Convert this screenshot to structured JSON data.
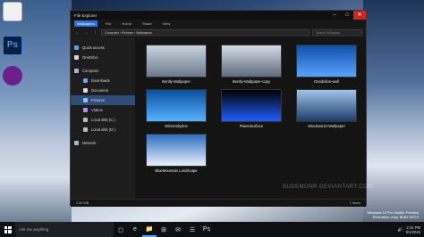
{
  "desktop": {
    "icons": [
      {
        "label": ""
      },
      {
        "label": "Ps"
      },
      {
        "label": ""
      }
    ],
    "build_info": [
      "Windows 10 Pro Insider Preview",
      "Evaluation copy. Build 10074"
    ]
  },
  "window": {
    "title": "File Explorer",
    "controls": {
      "minimize": "–",
      "maximize": "□",
      "close": "✕"
    },
    "ribbon_tabs": [
      "Wallpapers",
      "File",
      "Home",
      "Share",
      "View"
    ],
    "address": "Computer › Pictures › Wallpapers",
    "search_placeholder": "Search Windows",
    "sidebar": [
      {
        "label": "Quick access",
        "indent": false,
        "selected": false,
        "icon": "star-icon",
        "color": "#4aa3ff"
      },
      {
        "label": "OneDrive",
        "indent": false,
        "selected": false,
        "icon": "cloud-icon",
        "color": "#cfd8e3"
      },
      {
        "label": "Computer",
        "indent": false,
        "selected": false,
        "icon": "computer-icon",
        "color": "#9fb8d6"
      },
      {
        "label": "Downloads",
        "indent": true,
        "selected": false,
        "icon": "download-icon",
        "color": "#5fa8ff"
      },
      {
        "label": "Document",
        "indent": true,
        "selected": false,
        "icon": "document-icon",
        "color": "#d9d9d9"
      },
      {
        "label": "Pictures",
        "indent": true,
        "selected": true,
        "icon": "pictures-icon",
        "color": "#7fc7ff"
      },
      {
        "label": "Videos",
        "indent": true,
        "selected": false,
        "icon": "video-icon",
        "color": "#b58cff"
      },
      {
        "label": "Local disk (C:)",
        "indent": true,
        "selected": false,
        "icon": "disk-icon",
        "color": "#bbbbbb"
      },
      {
        "label": "Local disk (D:)",
        "indent": true,
        "selected": false,
        "icon": "disk-icon",
        "color": "#bbbbbb"
      },
      {
        "label": "Network",
        "indent": false,
        "selected": false,
        "icon": "network-icon",
        "color": "#9fb8d6"
      }
    ],
    "files": [
      {
        "name": "Bently-Wallpaper",
        "colors": [
          "#c9d3de",
          "#6b7a8c"
        ]
      },
      {
        "name": "Bently-Wallpaper-copy",
        "colors": [
          "#d4dce6",
          "#5e6b7b"
        ]
      },
      {
        "name": "Dandelion-wall",
        "colors": [
          "#0f4fa8",
          "#5aa3ff"
        ]
      },
      {
        "name": "WinterSkyline",
        "colors": [
          "#0b4f9c",
          "#55b3ff"
        ]
      },
      {
        "name": "PlanetSurface",
        "colors": [
          "#000000",
          "#1f5fff"
        ]
      },
      {
        "name": "Windows10-Wallpaper",
        "colors": [
          "#9fc4e8",
          "#1c3d6a"
        ]
      },
      {
        "name": "BlueMountain Landscape",
        "colors": [
          "#2d6fbf",
          "#e8f1fb"
        ]
      }
    ],
    "status": {
      "size": "2.55 MB",
      "count": "7 items"
    }
  },
  "watermark": "BUDEMONR.DEVIANTART.COM",
  "taskbar": {
    "search_placeholder": "Ask me anything",
    "apps": [
      "◻",
      "e",
      "📁",
      "⊞",
      "✉",
      "☰",
      "Ps"
    ],
    "time": "2:34 PM",
    "date": "5/1/2015"
  }
}
